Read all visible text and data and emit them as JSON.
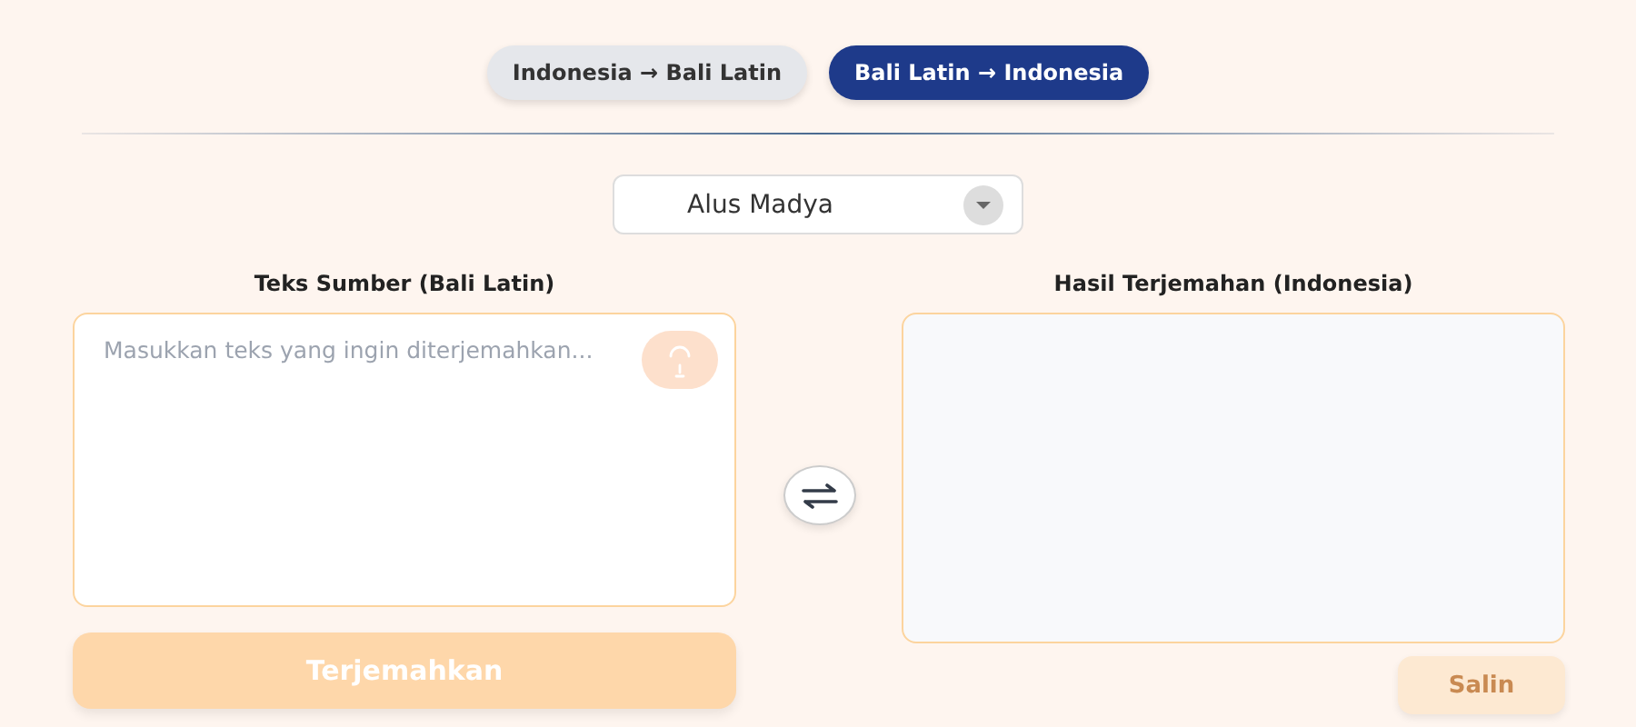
{
  "tabs": [
    {
      "label": "Indonesia → Bali Latin",
      "selected": false
    },
    {
      "label": "Bali Latin → Indonesia",
      "selected": true
    }
  ],
  "register_select": {
    "value": "Alus Madya"
  },
  "source": {
    "label": "Teks Sumber (Bali Latin)",
    "placeholder": "Masukkan teks yang ingin diterjemahkan...",
    "mic_disabled": true
  },
  "translate_button": {
    "label": "Terjemahkan",
    "disabled": true
  },
  "result": {
    "label": "Hasil Terjemahan (Indonesia)"
  },
  "copy_button": {
    "label": "Salin",
    "disabled": true
  }
}
